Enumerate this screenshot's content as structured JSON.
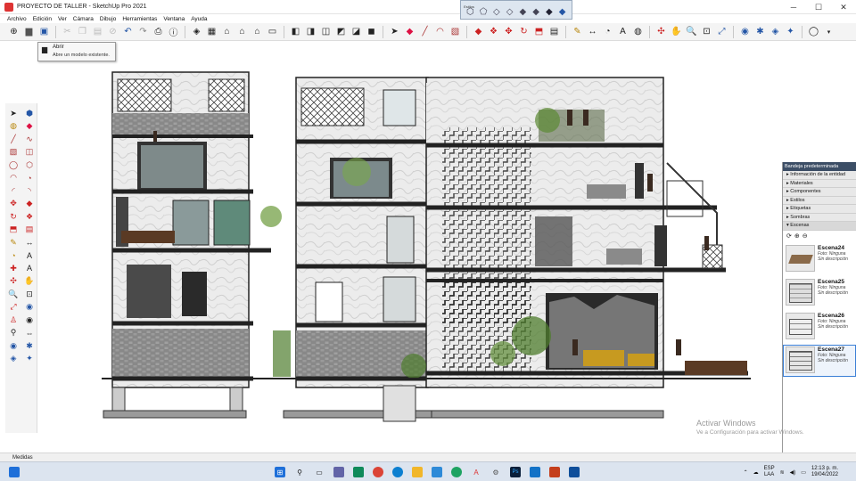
{
  "window": {
    "title": "PROYECTO DE TALLER - SketchUp Pro 2021",
    "controls": [
      "─",
      "☐",
      "✕"
    ]
  },
  "menu": [
    "Archivo",
    "Edición",
    "Ver",
    "Cámara",
    "Dibujo",
    "Herramientas",
    "Ventana",
    "Ayuda"
  ],
  "floating_toolbar": {
    "title": "Estilos"
  },
  "tooltip": {
    "title": "Abrir",
    "description": "Abre un modelo existente."
  },
  "tray_panel": {
    "title": "Bandeja predeterminada",
    "sections": [
      {
        "label": "▸ Información de la entidad"
      },
      {
        "label": "▸ Materiales"
      },
      {
        "label": "▸ Componentes"
      },
      {
        "label": "▸ Estilos"
      },
      {
        "label": "▸ Etiquetas"
      },
      {
        "label": "▸ Sombras"
      },
      {
        "label": "▾ Escenas"
      }
    ],
    "scenes": [
      {
        "name": "Escena24",
        "photo": "Foto: Ninguna",
        "desc": "Sin descripción"
      },
      {
        "name": "Escena25",
        "photo": "Foto: Ninguna",
        "desc": "Sin descripción"
      },
      {
        "name": "Escena26",
        "photo": "Foto: Ninguna",
        "desc": "Sin descripción"
      },
      {
        "name": "Escena27",
        "photo": "Foto: Ninguna",
        "desc": "Sin descripción"
      }
    ]
  },
  "status": {
    "measurements_label": "Medidas"
  },
  "watermark": {
    "line1": "Activar Windows",
    "line2": "Ve a Configuración para activar Windows."
  },
  "taskbar": {
    "lang": "ESP",
    "lang2": "LAA",
    "time": "12:13 p. m.",
    "date": "19/04/2022"
  }
}
